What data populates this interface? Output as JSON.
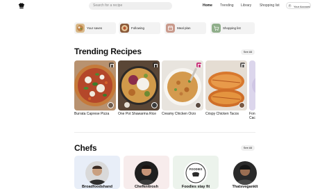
{
  "header": {
    "search_placeholder": "Search for a recipe",
    "nav": [
      "Home",
      "Trending",
      "Library",
      "Shopping list"
    ],
    "active_nav": "Home",
    "account": {
      "initial": "Z",
      "label": "Your Account"
    }
  },
  "quick_links": [
    {
      "label": "Your saves",
      "icon": "food-thumbnail"
    },
    {
      "label": "Following",
      "icon": "food-thumbnail"
    },
    {
      "label": "Meal plan",
      "icon": "calendar-icon"
    },
    {
      "label": "Shopping list",
      "icon": "cart-icon"
    }
  ],
  "trending": {
    "title": "Trending Recipes",
    "see_all": "See All",
    "recipes": [
      {
        "title": "Burrata Caprese Pizza"
      },
      {
        "title": "One Pot Shawarma Rice"
      },
      {
        "title": "Creamy Chicken Orzo"
      },
      {
        "title": "Crispy Chicken Tacos"
      },
      {
        "title": "Fon Cac"
      }
    ]
  },
  "chefs": {
    "title": "Chefs",
    "see_all": "See All",
    "items": [
      {
        "name": "Broadfoodshand"
      },
      {
        "name": "Chefknitrosh"
      },
      {
        "name": "Foodies stay fit",
        "logo_text": "FOODIES"
      },
      {
        "name": "Thatsveganklt"
      }
    ]
  },
  "colors": {
    "accent_pink": "#c9337a",
    "tile_background": "#f3f3f3"
  }
}
